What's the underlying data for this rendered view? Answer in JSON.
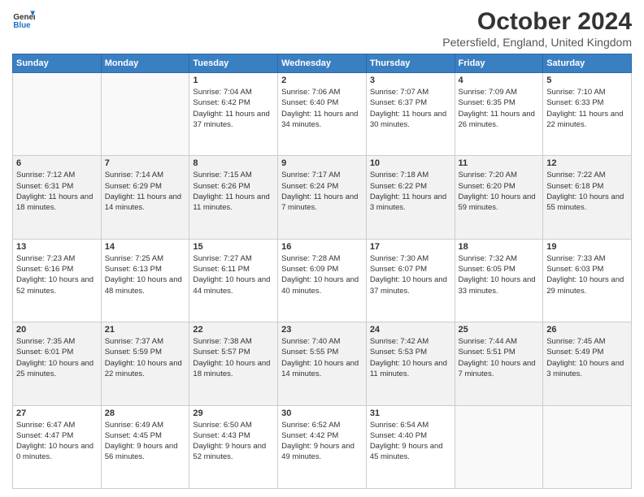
{
  "header": {
    "logo_line1": "General",
    "logo_line2": "Blue",
    "title": "October 2024",
    "subtitle": "Petersfield, England, United Kingdom"
  },
  "days_of_week": [
    "Sunday",
    "Monday",
    "Tuesday",
    "Wednesday",
    "Thursday",
    "Friday",
    "Saturday"
  ],
  "weeks": [
    [
      {
        "day": "",
        "info": ""
      },
      {
        "day": "",
        "info": ""
      },
      {
        "day": "1",
        "info": "Sunrise: 7:04 AM\nSunset: 6:42 PM\nDaylight: 11 hours and 37 minutes."
      },
      {
        "day": "2",
        "info": "Sunrise: 7:06 AM\nSunset: 6:40 PM\nDaylight: 11 hours and 34 minutes."
      },
      {
        "day": "3",
        "info": "Sunrise: 7:07 AM\nSunset: 6:37 PM\nDaylight: 11 hours and 30 minutes."
      },
      {
        "day": "4",
        "info": "Sunrise: 7:09 AM\nSunset: 6:35 PM\nDaylight: 11 hours and 26 minutes."
      },
      {
        "day": "5",
        "info": "Sunrise: 7:10 AM\nSunset: 6:33 PM\nDaylight: 11 hours and 22 minutes."
      }
    ],
    [
      {
        "day": "6",
        "info": "Sunrise: 7:12 AM\nSunset: 6:31 PM\nDaylight: 11 hours and 18 minutes."
      },
      {
        "day": "7",
        "info": "Sunrise: 7:14 AM\nSunset: 6:29 PM\nDaylight: 11 hours and 14 minutes."
      },
      {
        "day": "8",
        "info": "Sunrise: 7:15 AM\nSunset: 6:26 PM\nDaylight: 11 hours and 11 minutes."
      },
      {
        "day": "9",
        "info": "Sunrise: 7:17 AM\nSunset: 6:24 PM\nDaylight: 11 hours and 7 minutes."
      },
      {
        "day": "10",
        "info": "Sunrise: 7:18 AM\nSunset: 6:22 PM\nDaylight: 11 hours and 3 minutes."
      },
      {
        "day": "11",
        "info": "Sunrise: 7:20 AM\nSunset: 6:20 PM\nDaylight: 10 hours and 59 minutes."
      },
      {
        "day": "12",
        "info": "Sunrise: 7:22 AM\nSunset: 6:18 PM\nDaylight: 10 hours and 55 minutes."
      }
    ],
    [
      {
        "day": "13",
        "info": "Sunrise: 7:23 AM\nSunset: 6:16 PM\nDaylight: 10 hours and 52 minutes."
      },
      {
        "day": "14",
        "info": "Sunrise: 7:25 AM\nSunset: 6:13 PM\nDaylight: 10 hours and 48 minutes."
      },
      {
        "day": "15",
        "info": "Sunrise: 7:27 AM\nSunset: 6:11 PM\nDaylight: 10 hours and 44 minutes."
      },
      {
        "day": "16",
        "info": "Sunrise: 7:28 AM\nSunset: 6:09 PM\nDaylight: 10 hours and 40 minutes."
      },
      {
        "day": "17",
        "info": "Sunrise: 7:30 AM\nSunset: 6:07 PM\nDaylight: 10 hours and 37 minutes."
      },
      {
        "day": "18",
        "info": "Sunrise: 7:32 AM\nSunset: 6:05 PM\nDaylight: 10 hours and 33 minutes."
      },
      {
        "day": "19",
        "info": "Sunrise: 7:33 AM\nSunset: 6:03 PM\nDaylight: 10 hours and 29 minutes."
      }
    ],
    [
      {
        "day": "20",
        "info": "Sunrise: 7:35 AM\nSunset: 6:01 PM\nDaylight: 10 hours and 25 minutes."
      },
      {
        "day": "21",
        "info": "Sunrise: 7:37 AM\nSunset: 5:59 PM\nDaylight: 10 hours and 22 minutes."
      },
      {
        "day": "22",
        "info": "Sunrise: 7:38 AM\nSunset: 5:57 PM\nDaylight: 10 hours and 18 minutes."
      },
      {
        "day": "23",
        "info": "Sunrise: 7:40 AM\nSunset: 5:55 PM\nDaylight: 10 hours and 14 minutes."
      },
      {
        "day": "24",
        "info": "Sunrise: 7:42 AM\nSunset: 5:53 PM\nDaylight: 10 hours and 11 minutes."
      },
      {
        "day": "25",
        "info": "Sunrise: 7:44 AM\nSunset: 5:51 PM\nDaylight: 10 hours and 7 minutes."
      },
      {
        "day": "26",
        "info": "Sunrise: 7:45 AM\nSunset: 5:49 PM\nDaylight: 10 hours and 3 minutes."
      }
    ],
    [
      {
        "day": "27",
        "info": "Sunrise: 6:47 AM\nSunset: 4:47 PM\nDaylight: 10 hours and 0 minutes."
      },
      {
        "day": "28",
        "info": "Sunrise: 6:49 AM\nSunset: 4:45 PM\nDaylight: 9 hours and 56 minutes."
      },
      {
        "day": "29",
        "info": "Sunrise: 6:50 AM\nSunset: 4:43 PM\nDaylight: 9 hours and 52 minutes."
      },
      {
        "day": "30",
        "info": "Sunrise: 6:52 AM\nSunset: 4:42 PM\nDaylight: 9 hours and 49 minutes."
      },
      {
        "day": "31",
        "info": "Sunrise: 6:54 AM\nSunset: 4:40 PM\nDaylight: 9 hours and 45 minutes."
      },
      {
        "day": "",
        "info": ""
      },
      {
        "day": "",
        "info": ""
      }
    ]
  ]
}
